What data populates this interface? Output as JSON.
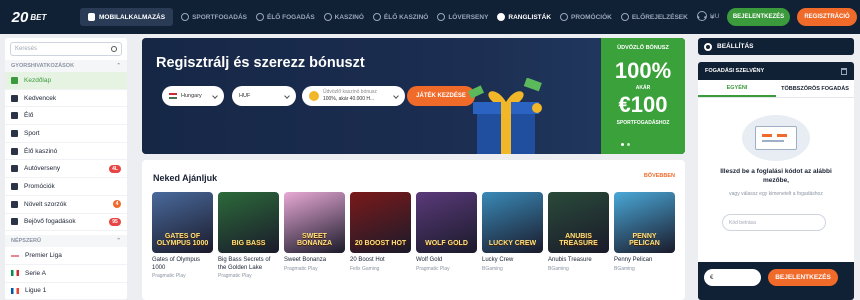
{
  "topnav": {
    "logo_num": "20",
    "logo_word": "BET",
    "mobile_app": "MOBILALKALMAZÁS",
    "links": [
      "SPORTFOGADÁS",
      "ÉLŐ FOGADÁS",
      "KASZINÓ",
      "ÉLŐ KASZINÓ",
      "LÓVERSENY",
      "RANGLISTÁK",
      "PROMÓCIÓK",
      "ELŐREJELZÉSEK"
    ],
    "active_link": "RANGLISTÁK",
    "more": "• • •",
    "lang": "HU",
    "login": "BEJELENTKEZÉS",
    "register": "REGISZTRÁCIÓ"
  },
  "sidebar": {
    "search_placeholder": "Keresés",
    "quick_title": "GYORSHIVATKOZÁSOK",
    "quick": [
      {
        "label": "Kezdőlap",
        "icon": "home-icon"
      },
      {
        "label": "Kedvencek",
        "icon": "star-icon"
      },
      {
        "label": "Élő",
        "icon": "live-icon"
      },
      {
        "label": "Sport",
        "icon": "ball-icon"
      },
      {
        "label": "Élő kaszinó",
        "icon": "dice-icon"
      },
      {
        "label": "Autóverseny",
        "icon": "car-icon",
        "badge": "4L"
      },
      {
        "label": "Promóciók",
        "icon": "gift-icon"
      },
      {
        "label": "Növelt szorzók",
        "icon": "boost-icon",
        "badge": "4"
      },
      {
        "label": "Bejövő fogadások",
        "icon": "clock-icon",
        "badge": "95"
      }
    ],
    "popular_title": "NÉPSZERŰ",
    "popular": [
      {
        "label": "Premier Liga"
      },
      {
        "label": "Serie A"
      },
      {
        "label": "Ligue 1"
      }
    ]
  },
  "banner": {
    "title": "Regisztrálj és szerezz bónuszt",
    "country": "Hungary",
    "currency": "HUF",
    "bonus_line1": "Üdvözlő kaszinó bónusz",
    "bonus_line2": "100%, akár 40.000 H...",
    "cta": "JÁTÉK KEZDÉSE",
    "promo_label": "ÜDVÖZLŐ BÓNUSZ",
    "promo_pct": "100%",
    "promo_upto": "AKÁR",
    "promo_amount": "€100",
    "promo_sub": "SPORTFOGADÁSHOZ"
  },
  "recs": {
    "title": "Neked Ajánljuk",
    "more": "BŐVEBBEN",
    "games": [
      {
        "name": "Gates of Olympus 1000",
        "provider": "Pragmatic Play",
        "thumb_text": "GATES OF OLYMPUS 1000",
        "bg": "#4a6a9c"
      },
      {
        "name": "Big Bass Secrets of the Golden Lake",
        "provider": "Pragmatic Play",
        "thumb_text": "BIG BASS",
        "bg": "#2c6a3a"
      },
      {
        "name": "Sweet Bonanza",
        "provider": "Pragmatic Play",
        "thumb_text": "SWEET BONANZA",
        "bg": "#e8a9d6"
      },
      {
        "name": "20 Boost Hot",
        "provider": "Felix Gaming",
        "thumb_text": "20 BOOST HOT",
        "bg": "#7a1a1a"
      },
      {
        "name": "Wolf Gold",
        "provider": "Pragmatic Play",
        "thumb_text": "WOLF GOLD",
        "bg": "#5a3a7a"
      },
      {
        "name": "Lucky Crew",
        "provider": "BGaming",
        "thumb_text": "LUCKY CREW",
        "bg": "#3a8ab8"
      },
      {
        "name": "Anubis Treasure",
        "provider": "BGaming",
        "thumb_text": "ANUBIS TREASURE",
        "bg": "#2a4a3a"
      },
      {
        "name": "Penny Pelican",
        "provider": "BGaming",
        "thumb_text": "PENNY PELICAN",
        "bg": "#4aa8d8"
      }
    ]
  },
  "rightpanel": {
    "settings": "BEÁLLÍTÁS",
    "slip_title": "FOGADÁSI SZELVÉNY",
    "tab_single": "EGYÉNI",
    "tab_multi": "TÖBBSZÖRÖS FOGADÁS",
    "empty_text": "Illeszd be a foglalási kódot az alábbi mezőbe,",
    "empty_sub": "vagy válassz egy kimenetelt a fogadáshoz",
    "code_placeholder": "Kód beírása",
    "currency": "€",
    "bet_button": "BEJELENTKEZÉS"
  },
  "colors": {
    "nav_bg": "#102035",
    "accent_green": "#3b9a3c",
    "accent_orange": "#f06a2a"
  }
}
